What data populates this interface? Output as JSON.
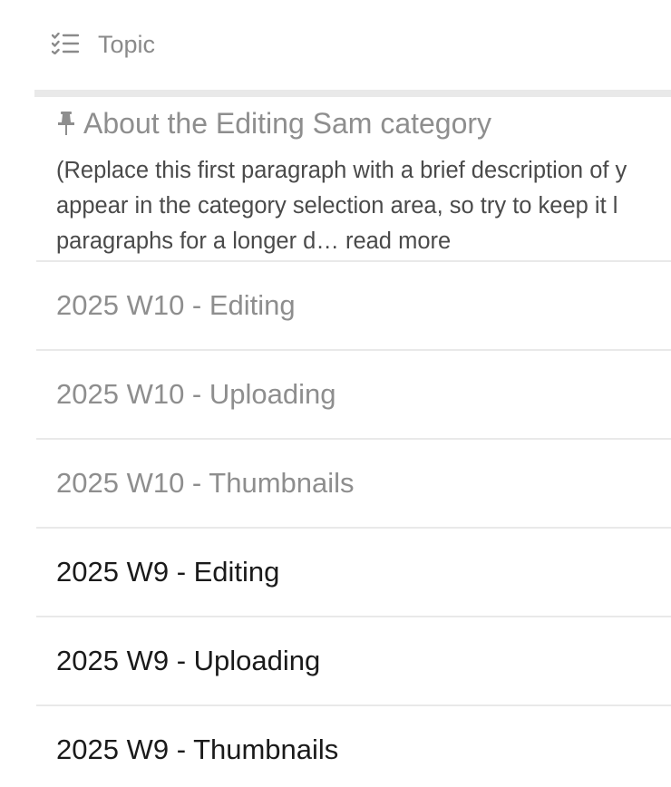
{
  "header": {
    "column_label": "Topic",
    "icon": "list-check-icon"
  },
  "pinned_topic": {
    "icon": "pin-icon",
    "title": "About the Editing Sam category",
    "excerpt_lines": [
      "(Replace this first paragraph with a brief description of y",
      "appear in the category selection area, so try to keep it l",
      "paragraphs for a longer d…"
    ],
    "read_more_label": "read more"
  },
  "topics": [
    {
      "title": "2025 W10 - Editing",
      "state": "read"
    },
    {
      "title": "2025 W10 - Uploading",
      "state": "read"
    },
    {
      "title": "2025 W10 - Thumbnails",
      "state": "read"
    },
    {
      "title": "2025 W9 - Editing",
      "state": "unread"
    },
    {
      "title": "2025 W9 - Uploading",
      "state": "unread"
    },
    {
      "title": "2025 W9 - Thumbnails",
      "state": "unread"
    }
  ],
  "colors": {
    "read_text": "#8e8e8e",
    "unread_text": "#1a1a1a",
    "divider": "#e9e9e9"
  }
}
